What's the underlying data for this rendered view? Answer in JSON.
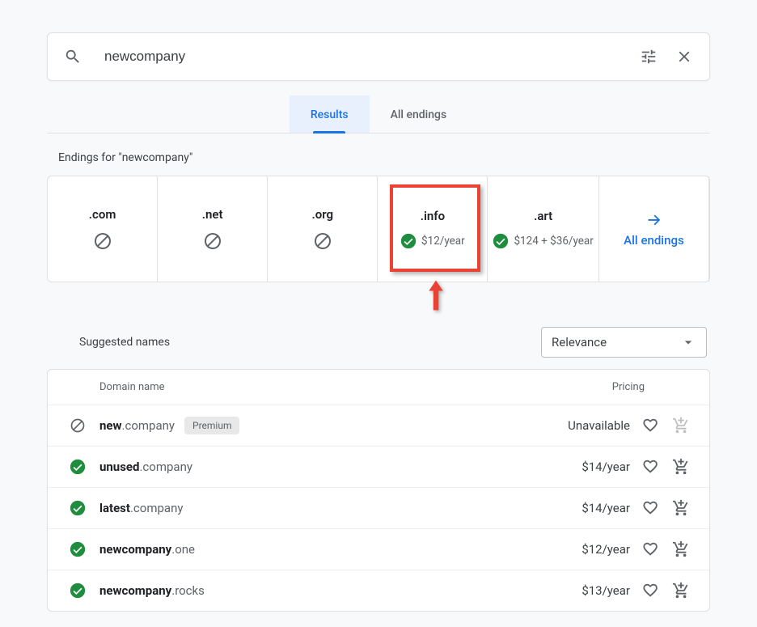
{
  "search": {
    "query": "newcompany"
  },
  "tabs": {
    "results": "Results",
    "all_endings": "All endings"
  },
  "endings_label": "Endings for \"newcompany\"",
  "endings": [
    {
      "name": ".com",
      "available": false
    },
    {
      "name": ".net",
      "available": false
    },
    {
      "name": ".org",
      "available": false
    },
    {
      "name": ".info",
      "available": true,
      "price": "$12/year"
    },
    {
      "name": ".art",
      "available": true,
      "price": "$124 + $36/year"
    }
  ],
  "all_endings_link": "All endings",
  "suggested_label": "Suggested names",
  "sort_value": "Relevance",
  "table_head": {
    "domain": "Domain name",
    "pricing": "Pricing"
  },
  "rows": [
    {
      "status": "blocked",
      "bold": "new",
      "rest": ".company",
      "premium": "Premium",
      "price": "Unavailable",
      "cart": false
    },
    {
      "status": "ok",
      "bold": "unused",
      "rest": ".company",
      "price": "$14/year",
      "cart": true
    },
    {
      "status": "ok",
      "bold": "latest",
      "rest": ".company",
      "price": "$14/year",
      "cart": true
    },
    {
      "status": "ok",
      "bold": "newcompany",
      "rest": ".one",
      "price": "$12/year",
      "cart": true
    },
    {
      "status": "ok",
      "bold": "newcompany",
      "rest": ".rocks",
      "price": "$13/year",
      "cart": true
    }
  ]
}
